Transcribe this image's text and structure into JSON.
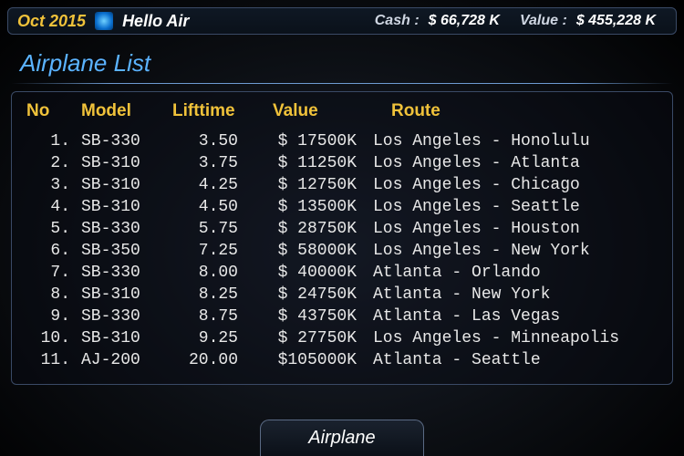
{
  "topbar": {
    "date": "Oct 2015",
    "airline_name": "Hello Air",
    "cash_label": "Cash :",
    "cash_value": "$ 66,728 K",
    "value_label": "Value :",
    "value_value": "$ 455,228 K"
  },
  "panel": {
    "title": "Airplane List",
    "headers": {
      "no": "No",
      "model": "Model",
      "lifetime": "Lifttime",
      "value": "Value",
      "route": "Route"
    },
    "rows": [
      {
        "no": "1.",
        "model": "SB-330",
        "lifetime": "3.50",
        "value": "$ 17500K",
        "route": "Los Angeles - Honolulu"
      },
      {
        "no": "2.",
        "model": "SB-310",
        "lifetime": "3.75",
        "value": "$ 11250K",
        "route": "Los Angeles - Atlanta"
      },
      {
        "no": "3.",
        "model": "SB-310",
        "lifetime": "4.25",
        "value": "$ 12750K",
        "route": "Los Angeles - Chicago"
      },
      {
        "no": "4.",
        "model": "SB-310",
        "lifetime": "4.50",
        "value": "$ 13500K",
        "route": "Los Angeles - Seattle"
      },
      {
        "no": "5.",
        "model": "SB-330",
        "lifetime": "5.75",
        "value": "$ 28750K",
        "route": "Los Angeles - Houston"
      },
      {
        "no": "6.",
        "model": "SB-350",
        "lifetime": "7.25",
        "value": "$ 58000K",
        "route": "Los Angeles - New York"
      },
      {
        "no": "7.",
        "model": "SB-330",
        "lifetime": "8.00",
        "value": "$ 40000K",
        "route": "Atlanta - Orlando"
      },
      {
        "no": "8.",
        "model": "SB-310",
        "lifetime": "8.25",
        "value": "$ 24750K",
        "route": "Atlanta - New York"
      },
      {
        "no": "9.",
        "model": "SB-330",
        "lifetime": "8.75",
        "value": "$ 43750K",
        "route": "Atlanta - Las Vegas"
      },
      {
        "no": "10.",
        "model": "SB-310",
        "lifetime": "9.25",
        "value": "$ 27750K",
        "route": "Los Angeles - Minneapolis"
      },
      {
        "no": "11.",
        "model": "AJ-200",
        "lifetime": "20.00",
        "value": "$105000K",
        "route": "Atlanta - Seattle"
      }
    ]
  },
  "bottom_button": {
    "label": "Airplane"
  }
}
